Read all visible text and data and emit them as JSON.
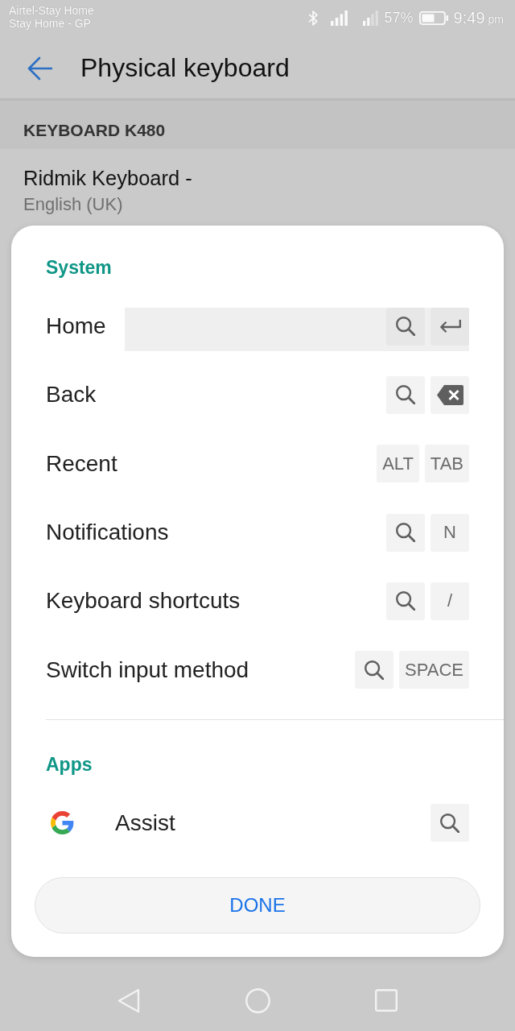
{
  "status_bar": {
    "carrier_lines": [
      "Airtel-Stay Home",
      "Stay Home - GP"
    ],
    "battery": "57%",
    "time": "9:49",
    "time_suffix": "pm"
  },
  "app_bar": {
    "title": "Physical keyboard"
  },
  "keyboard_list": {
    "header": "KEYBOARD K480",
    "items": [
      {
        "title": "Ridmik Keyboard -",
        "subtitle": "English (UK)"
      }
    ]
  },
  "dialog": {
    "sections": [
      {
        "title": "System",
        "rows": [
          {
            "kind": "shortcut",
            "label": "Home",
            "selected": true,
            "keys": [
              {
                "kind": "search"
              },
              {
                "kind": "enter"
              }
            ]
          },
          {
            "kind": "shortcut",
            "label": "Back",
            "selected": false,
            "keys": [
              {
                "kind": "search"
              },
              {
                "kind": "backspace"
              }
            ]
          },
          {
            "kind": "shortcut",
            "label": "Recent",
            "selected": false,
            "keys": [
              {
                "kind": "text",
                "label": "ALT"
              },
              {
                "kind": "text",
                "label": "TAB"
              }
            ]
          },
          {
            "kind": "shortcut",
            "label": "Notifications",
            "selected": false,
            "keys": [
              {
                "kind": "search"
              },
              {
                "kind": "text",
                "label": "N"
              }
            ]
          },
          {
            "kind": "shortcut",
            "label": "Keyboard shortcuts",
            "selected": false,
            "keys": [
              {
                "kind": "search"
              },
              {
                "kind": "text",
                "label": "/"
              }
            ]
          },
          {
            "kind": "shortcut",
            "label": "Switch input method",
            "selected": false,
            "keys": [
              {
                "kind": "search"
              },
              {
                "kind": "text",
                "label": "SPACE"
              }
            ]
          }
        ]
      },
      {
        "title": "Apps",
        "rows": [
          {
            "kind": "app",
            "label": "Assist",
            "selected": false,
            "keys": [
              {
                "kind": "search"
              }
            ]
          }
        ]
      }
    ],
    "button": "DONE"
  }
}
